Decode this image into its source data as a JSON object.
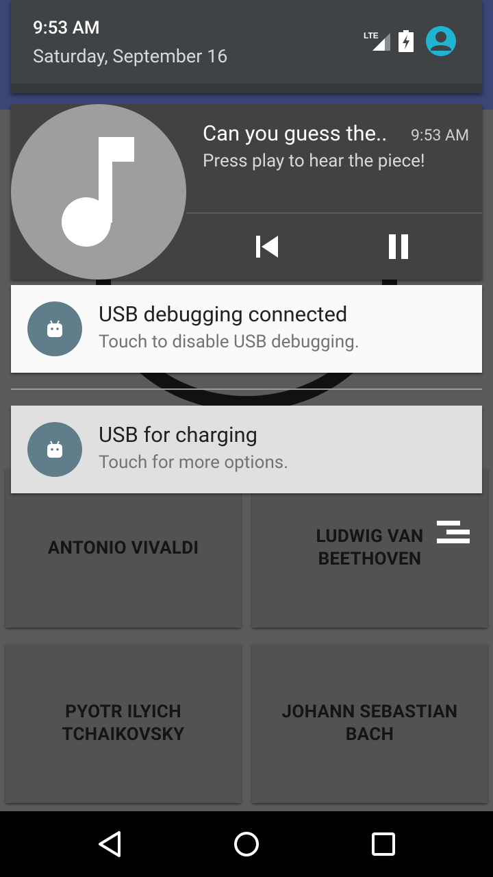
{
  "status": {
    "time": "9:53 AM",
    "date": "Saturday, September 16",
    "network_label": "LTE",
    "icons": [
      "lte-signal-icon",
      "battery-charging-icon",
      "user-avatar-icon"
    ]
  },
  "media_notification": {
    "title": "Can you guess the..",
    "time": "9:53 AM",
    "text": "Press play to hear the piece!",
    "art_icon": "music-note-icon",
    "actions": [
      "skip-previous-icon",
      "pause-icon"
    ]
  },
  "notifications": [
    {
      "title": "USB debugging connected",
      "text": "Touch to disable USB debugging.",
      "icon": "android-icon"
    },
    {
      "title": "USB for charging",
      "text": "Touch for more options.",
      "icon": "android-icon"
    }
  ],
  "app": {
    "answers": [
      {
        "line1": "ANTONIO VIVALDI",
        "line2": ""
      },
      {
        "line1": "LUDWIG VAN",
        "line2": "BEETHOVEN"
      },
      {
        "line1": "PYOTR ILYICH",
        "line2": "TCHAIKOVSKY"
      },
      {
        "line1": "JOHANN SEBASTIAN",
        "line2": "BACH"
      }
    ]
  },
  "navbar": {
    "buttons": [
      "back-icon",
      "home-icon",
      "recents-icon"
    ]
  },
  "colors": {
    "app_bar": "#3b4674",
    "shade_header": "#3f4346",
    "media_card": "#424242",
    "notif_icon_bg": "#607d8b",
    "avatar": "#1eb4d2"
  }
}
